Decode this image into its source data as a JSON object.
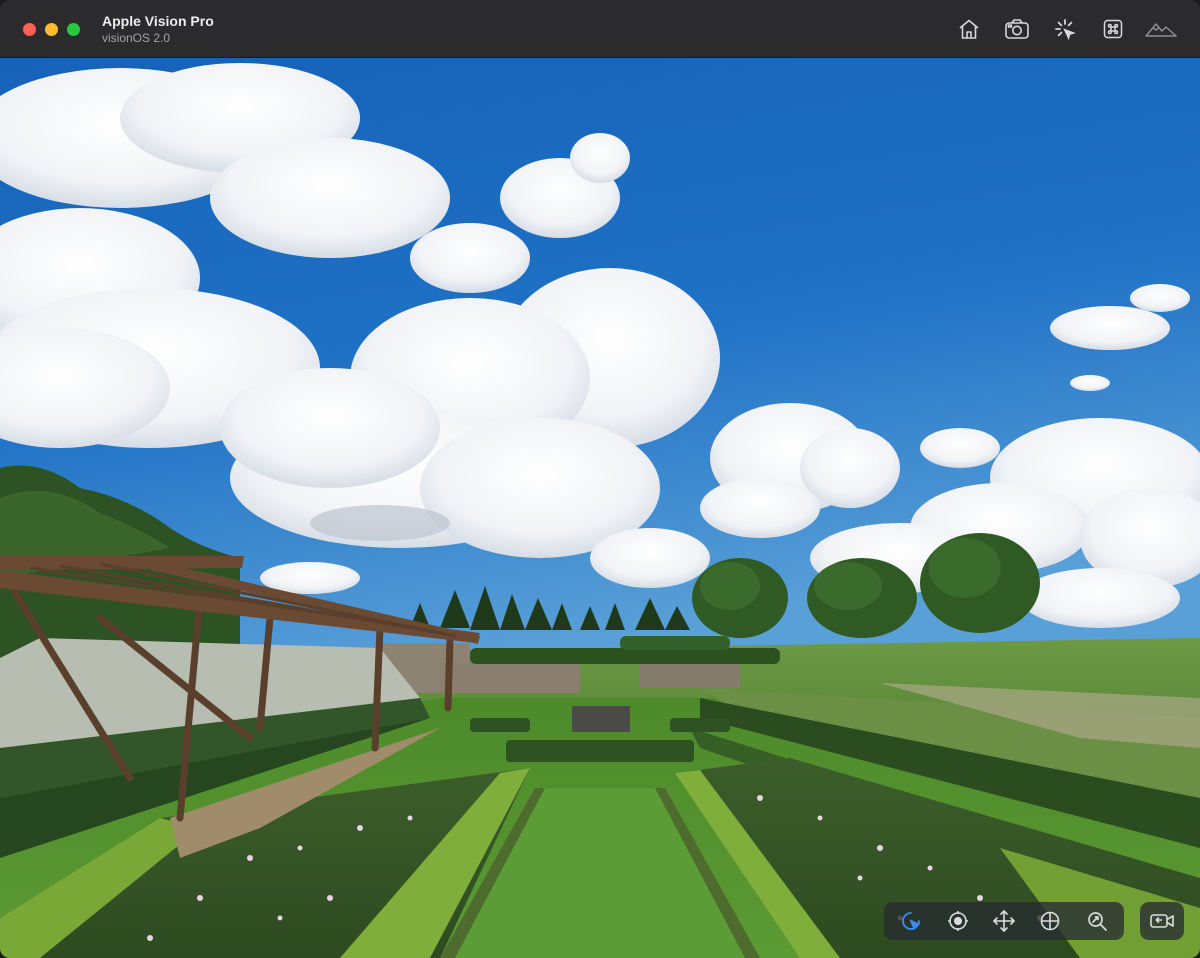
{
  "window": {
    "title": "Apple Vision Pro",
    "subtitle": "visionOS 2.0"
  },
  "toolbar": {
    "icons": [
      "home-icon",
      "screenshot-camera-icon",
      "loading-spinner-icon",
      "command-key-icon",
      "environment-mountains-icon"
    ]
  },
  "controls": {
    "icons": [
      "tap-pointer-icon",
      "look-target-icon",
      "move-arrows-icon",
      "orbit-sphere-icon",
      "zoom-magnifier-icon"
    ],
    "camera": "camera-switch-icon",
    "active_index": 0
  },
  "colors": {
    "accent": "#3b8df5",
    "sky": "#1e6fc2",
    "grass": "#4f8a2e"
  }
}
